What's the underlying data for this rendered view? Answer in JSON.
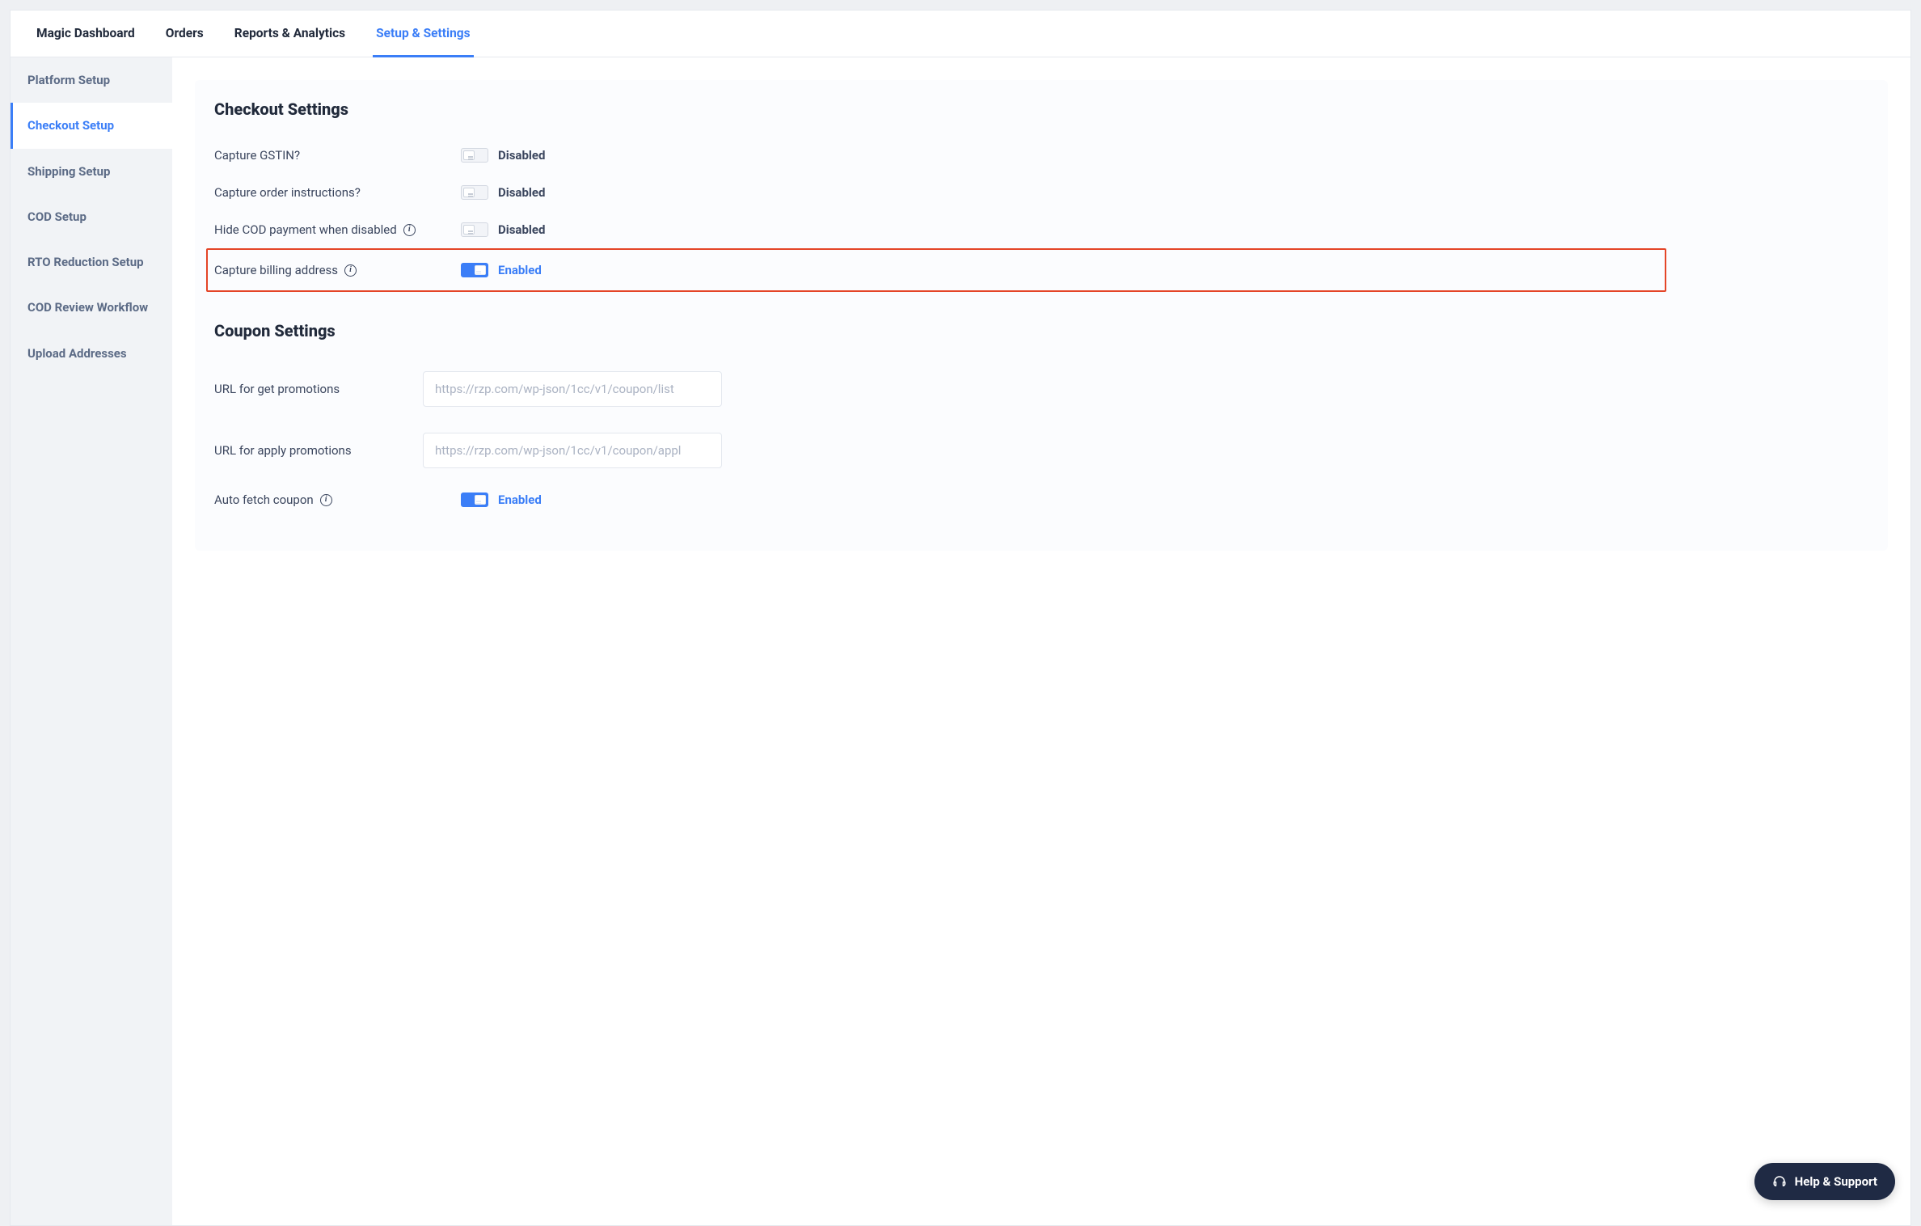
{
  "tabs": {
    "magic_dashboard": "Magic Dashboard",
    "orders": "Orders",
    "reports_analytics": "Reports & Analytics",
    "setup_settings": "Setup & Settings"
  },
  "sidebar": {
    "platform_setup": "Platform Setup",
    "checkout_setup": "Checkout Setup",
    "shipping_setup": "Shipping Setup",
    "cod_setup": "COD Setup",
    "rto_reduction_setup": "RTO Reduction Setup",
    "cod_review_workflow": "COD Review Workflow",
    "upload_addresses": "Upload Addresses"
  },
  "checkout_settings": {
    "title": "Checkout Settings",
    "rows": {
      "capture_gstin": {
        "label": "Capture GSTIN?",
        "status": "Disabled"
      },
      "capture_order_instructions": {
        "label": "Capture order instructions?",
        "status": "Disabled"
      },
      "hide_cod": {
        "label": "Hide COD payment when disabled",
        "status": "Disabled"
      },
      "capture_billing": {
        "label": "Capture billing address",
        "status": "Enabled"
      }
    }
  },
  "coupon_settings": {
    "title": "Coupon Settings",
    "url_get": {
      "label": "URL for get promotions",
      "value": "https://rzp.com/wp-json/1cc/v1/coupon/list"
    },
    "url_apply": {
      "label": "URL for apply promotions",
      "value": "https://rzp.com/wp-json/1cc/v1/coupon/appl"
    },
    "auto_fetch": {
      "label": "Auto fetch coupon",
      "status": "Enabled"
    }
  },
  "help_fab": "Help & Support"
}
